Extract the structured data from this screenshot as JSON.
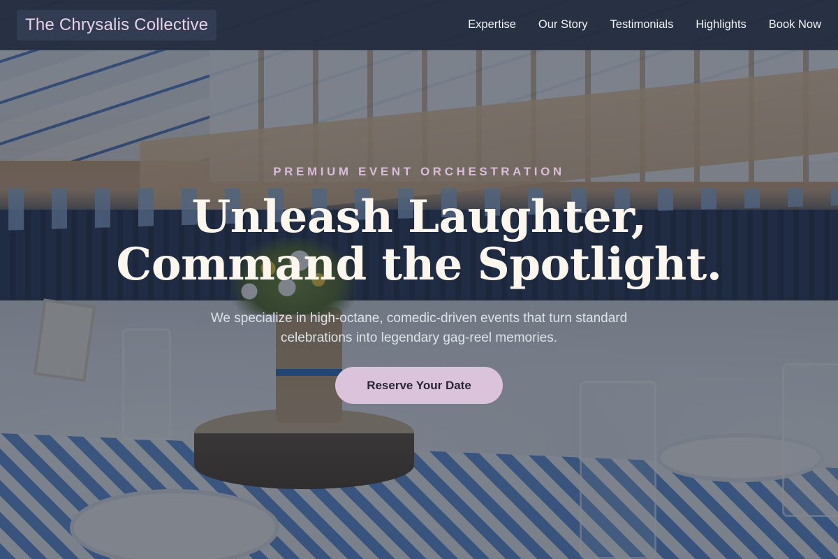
{
  "header": {
    "brand": "The Chrysalis Collective",
    "nav": [
      {
        "label": "Expertise"
      },
      {
        "label": "Our Story"
      },
      {
        "label": "Testimonials"
      },
      {
        "label": "Highlights"
      },
      {
        "label": "Book Now"
      }
    ]
  },
  "hero": {
    "eyebrow": "PREMIUM EVENT ORCHESTRATION",
    "headline_line1": "Unleash Laughter,",
    "headline_line2": "Command the Spotlight.",
    "subtitle": "We specialize in high-octane, comedic-driven events that turn standard celebrations into legendary gag-reel memories.",
    "cta_label": "Reserve Your Date"
  },
  "colors": {
    "header_bg": "#242e42",
    "brand_text": "#e8d2e8",
    "eyebrow": "#d8bcd8",
    "headline": "#fbf7ee",
    "cta_bg": "#dcc3dc",
    "cta_text": "#2a2438"
  }
}
